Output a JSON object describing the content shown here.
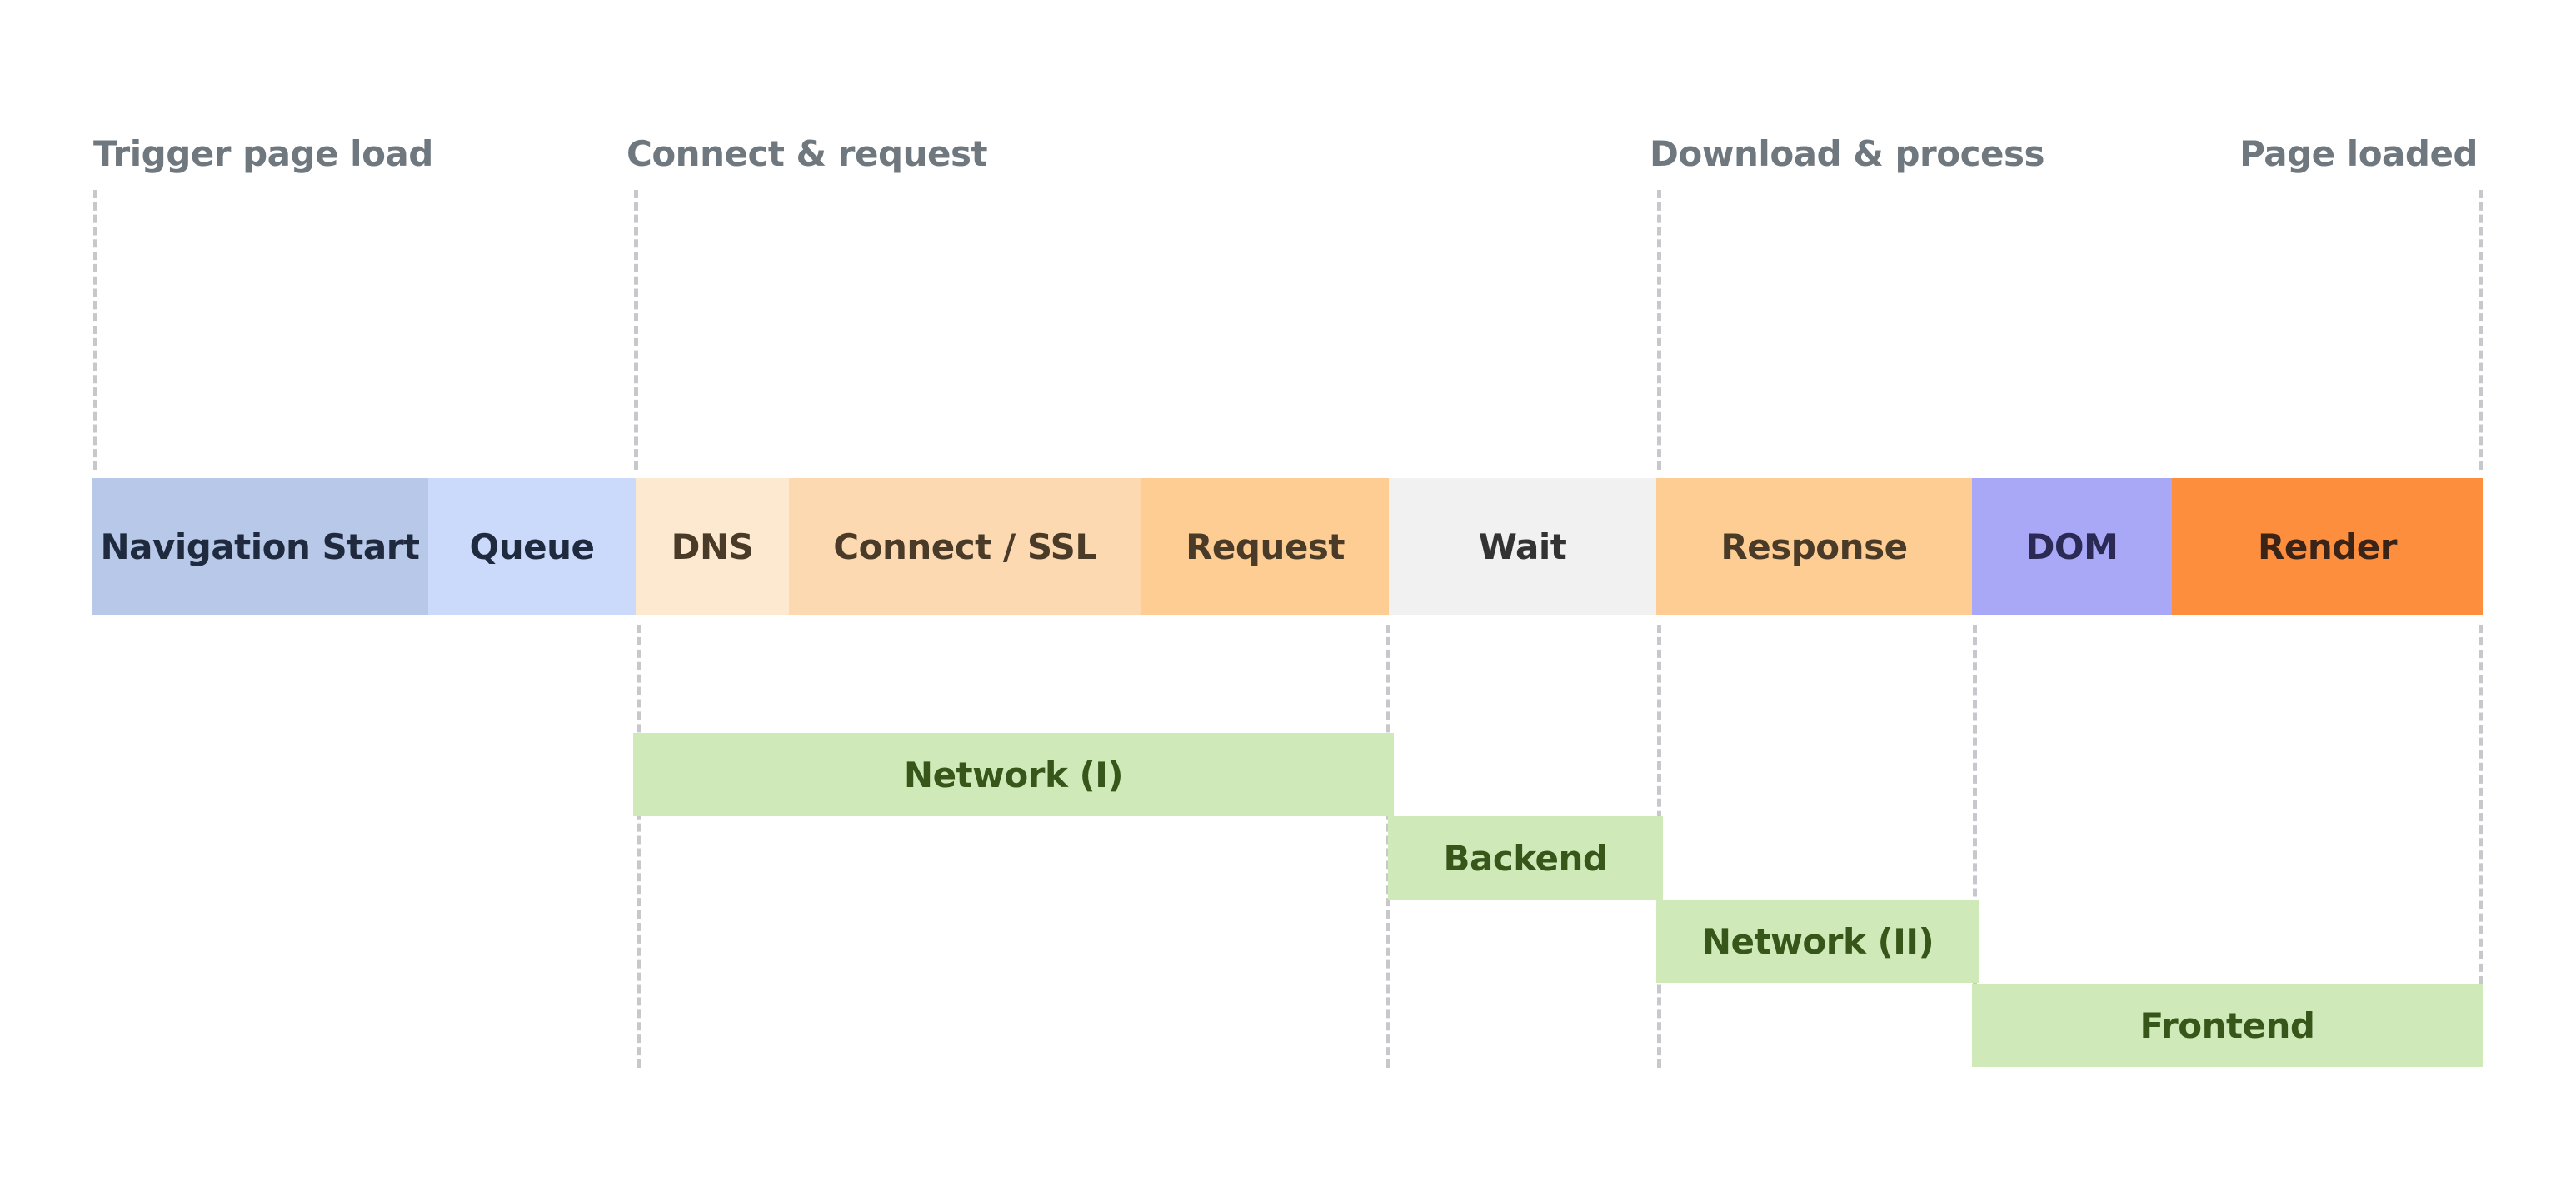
{
  "milestones": [
    {
      "label": "Trigger page load"
    },
    {
      "label": "Connect & request"
    },
    {
      "label": "Download & process"
    },
    {
      "label": "Page loaded"
    }
  ],
  "timeline_segments": [
    {
      "label": "Navigation Start",
      "color": "#b7c8e9",
      "text_color": "#1f2a3f"
    },
    {
      "label": "Queue",
      "color": "#cbdafb",
      "text_color": "#1f2a3f"
    },
    {
      "label": "DNS",
      "color": "#fde8d0",
      "text_color": "#4a3a28"
    },
    {
      "label": "Connect / SSL",
      "color": "#fcd9b1",
      "text_color": "#4a3a28"
    },
    {
      "label": "Request",
      "color": "#fecd94",
      "text_color": "#4a3a28"
    },
    {
      "label": "Wait",
      "color": "#f1f1f1",
      "text_color": "#333333"
    },
    {
      "label": "Response",
      "color": "#fecd94",
      "text_color": "#4a3a28"
    },
    {
      "label": "DOM",
      "color": "#a9a8f7",
      "text_color": "#2b2a55"
    },
    {
      "label": "Render",
      "color": "#fd8e3e",
      "text_color": "#3a2418"
    }
  ],
  "phases": [
    {
      "label": "Network (I)",
      "spans": "DNS – Request"
    },
    {
      "label": "Backend",
      "spans": "Wait"
    },
    {
      "label": "Network (II)",
      "spans": "Response"
    },
    {
      "label": "Frontend",
      "spans": "DOM – Render"
    }
  ],
  "colors": {
    "phase_fill": "#cfe9b8",
    "phase_text": "#37571a",
    "milestone_text": "#6f787f",
    "divider": "#c6c8cb"
  }
}
